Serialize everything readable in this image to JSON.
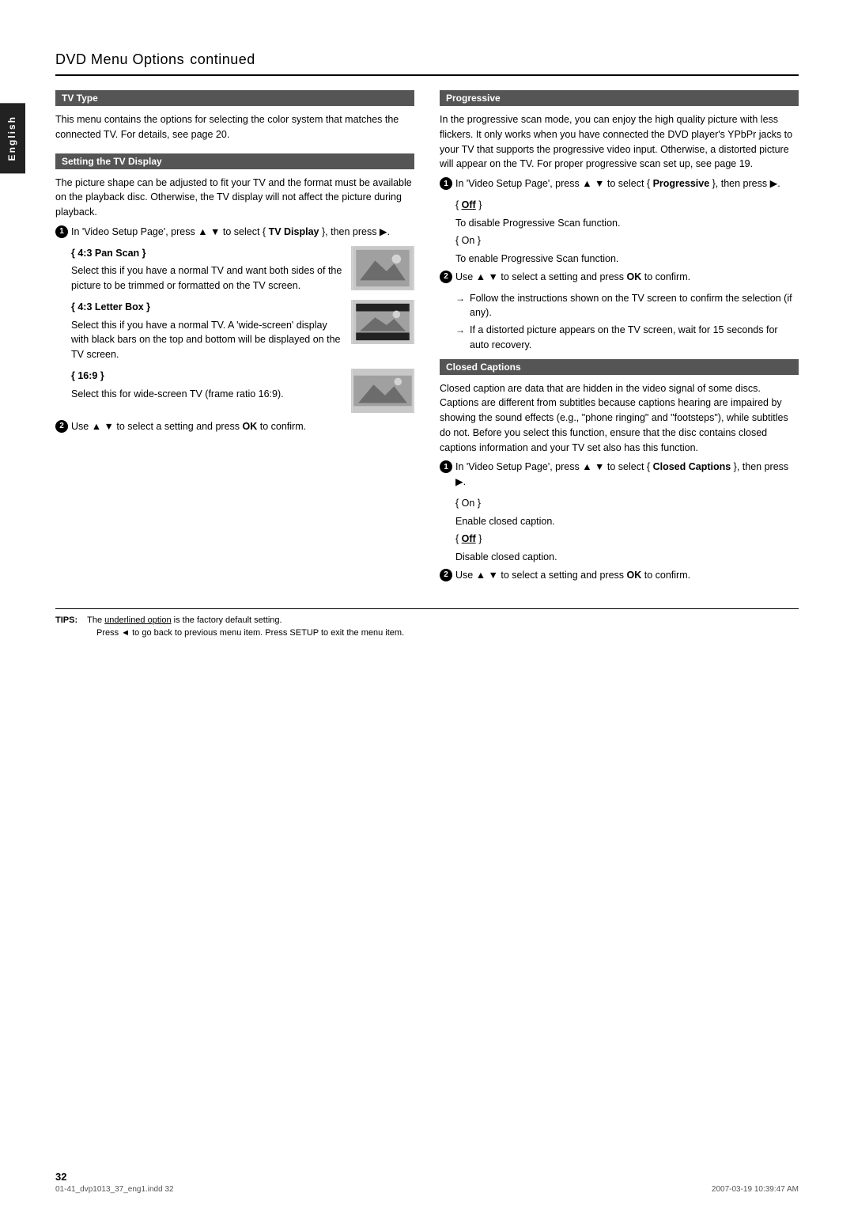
{
  "page": {
    "title": "DVD Menu Options",
    "title_suffix": "continued",
    "page_number": "32",
    "sidebar_label": "English"
  },
  "left_column": {
    "tv_type": {
      "header": "TV Type",
      "body": "This menu contains the options for selecting the color system that matches the connected TV. For details, see page 20."
    },
    "setting_tv_display": {
      "header": "Setting the TV Display",
      "body": "The picture shape can be adjusted to fit your TV and the format must be available on the playback disc. Otherwise, the TV display will not affect the picture during playback.",
      "step1": {
        "num": "1",
        "text": "In 'Video Setup Page', press ▲ ▼ to select { ",
        "bold": "TV Display",
        "text2": " }, then press ▶."
      },
      "options": {
        "pan_scan_label": "{ 4:3 Pan Scan }",
        "pan_scan_text": "Select this if you have a normal TV and want both sides of the picture to be trimmed or formatted on the TV screen.",
        "letter_box_label": "{ 4:3 Letter Box }",
        "letter_box_text": "Select this if you have a normal TV. A 'wide-screen' display with black bars on the top and bottom will be displayed on the TV screen.",
        "ratio_label": "{ 16:9 }",
        "ratio_text": "Select this for wide-screen TV (frame ratio 16:9)."
      },
      "step2": {
        "num": "2",
        "text": "Use ▲ ▼ to select a setting and press ",
        "bold": "OK",
        "text2": " to confirm."
      }
    }
  },
  "right_column": {
    "progressive": {
      "header": "Progressive",
      "body": "In the progressive scan mode, you can enjoy the high quality picture with less flickers. It only works when you have connected the DVD player's YPbPr jacks to your TV that supports the progressive video input. Otherwise, a distorted picture will appear on the TV. For proper progressive scan set up, see page 19.",
      "step1": {
        "num": "1",
        "text": "In 'Video Setup Page', press ▲ ▼ to select { ",
        "bold": "Progressive",
        "text2": " }, then press ▶."
      },
      "off_label": "{ Off }",
      "off_desc": "To disable Progressive Scan function.",
      "on_label": "{ On }",
      "on_desc": "To enable Progressive Scan function.",
      "step2": {
        "num": "2",
        "text": "Use ▲ ▼ to select a setting and press ",
        "bold": "OK",
        "text2": " to confirm."
      },
      "arrow1": "Follow the instructions shown on the TV screen to confirm the selection (if any).",
      "arrow2": "If a distorted picture appears on the TV screen, wait for 15 seconds for auto recovery."
    },
    "closed_captions": {
      "header": "Closed Captions",
      "body": "Closed caption are data that are hidden in the video signal of some discs. Captions are different from subtitles because captions hearing are impaired by showing the sound effects (e.g., \"phone ringing\" and \"footsteps\"), while subtitles do not. Before you select this function, ensure that the disc contains closed captions information and your TV set also has this function.",
      "step1": {
        "num": "1",
        "text": "In 'Video Setup Page', press ▲ ▼ to select { ",
        "bold": "Closed Captions",
        "text2": " }, then press ▶."
      },
      "on_label": "{ On }",
      "on_desc": "Enable closed caption.",
      "off_label": "{ Off }",
      "off_desc": "Disable closed caption.",
      "step2": {
        "num": "2",
        "text": "Use ▲ ▼ to select a setting and press ",
        "bold": "OK",
        "text2": " to confirm."
      }
    }
  },
  "tips": {
    "label": "TIPS:",
    "line1": "The underlined option is the factory default setting.",
    "line2": "Press ◄ to go back to previous menu item. Press SETUP to exit the menu item."
  },
  "footer": {
    "left": "01-41_dvp1013_37_eng1.indd  32",
    "right": "2007-03-19   10:39:47 AM"
  }
}
